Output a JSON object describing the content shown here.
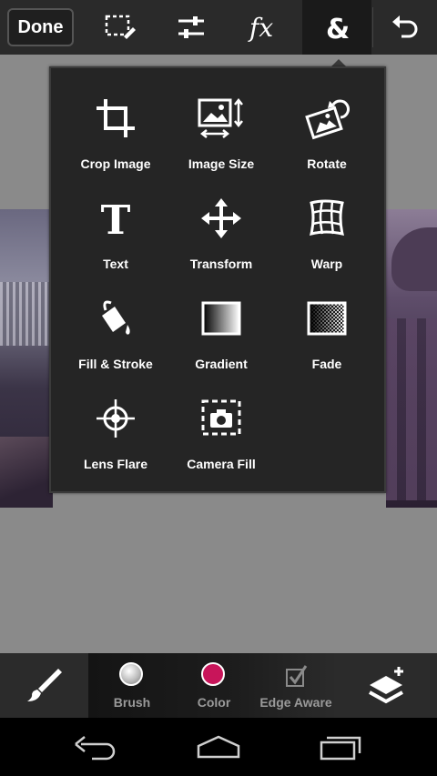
{
  "toolbar": {
    "done_label": "Done",
    "icons": [
      "selection-icon",
      "adjustments-icon",
      "effects-fx-icon",
      "ampersand-icon",
      "undo-icon"
    ],
    "active": "ampersand-icon"
  },
  "menu": {
    "items": [
      {
        "label": "Crop Image",
        "icon": "crop-icon"
      },
      {
        "label": "Image Size",
        "icon": "image-size-icon"
      },
      {
        "label": "Rotate",
        "icon": "rotate-icon"
      },
      {
        "label": "Text",
        "icon": "text-icon"
      },
      {
        "label": "Transform",
        "icon": "transform-icon"
      },
      {
        "label": "Warp",
        "icon": "warp-icon"
      },
      {
        "label": "Fill & Stroke",
        "icon": "fill-stroke-icon"
      },
      {
        "label": "Gradient",
        "icon": "gradient-icon"
      },
      {
        "label": "Fade",
        "icon": "fade-icon"
      },
      {
        "label": "Lens Flare",
        "icon": "lens-flare-icon"
      },
      {
        "label": "Camera Fill",
        "icon": "camera-fill-icon"
      }
    ]
  },
  "bottom": {
    "brush_label": "Brush",
    "color_label": "Color",
    "edge_aware_label": "Edge Aware",
    "color_value": "#c8155a",
    "brush_color": "#bdbdbd"
  },
  "colors": {
    "accent": "#c8155a",
    "panel": "#252525"
  }
}
